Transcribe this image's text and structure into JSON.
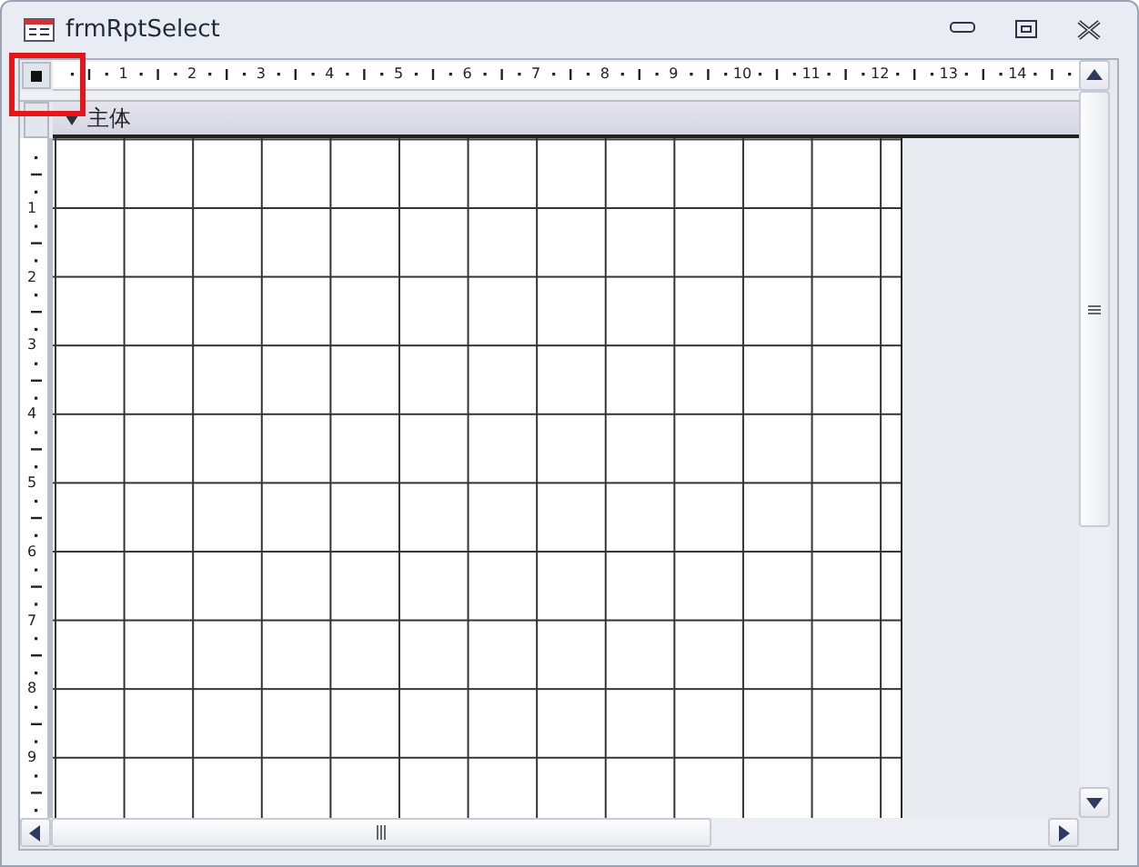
{
  "window": {
    "title": "frmRptSelect"
  },
  "ruler": {
    "horizontal_labels": [
      "1",
      "2",
      "3",
      "4",
      "5",
      "6",
      "7",
      "8",
      "9",
      "10",
      "11",
      "12",
      "13",
      "14"
    ],
    "vertical_labels": [
      "1",
      "2",
      "3",
      "4",
      "5",
      "6",
      "7",
      "8",
      "9"
    ]
  },
  "section": {
    "label": "主体",
    "expanded": true
  },
  "form_selector": {
    "highlighted": true
  }
}
